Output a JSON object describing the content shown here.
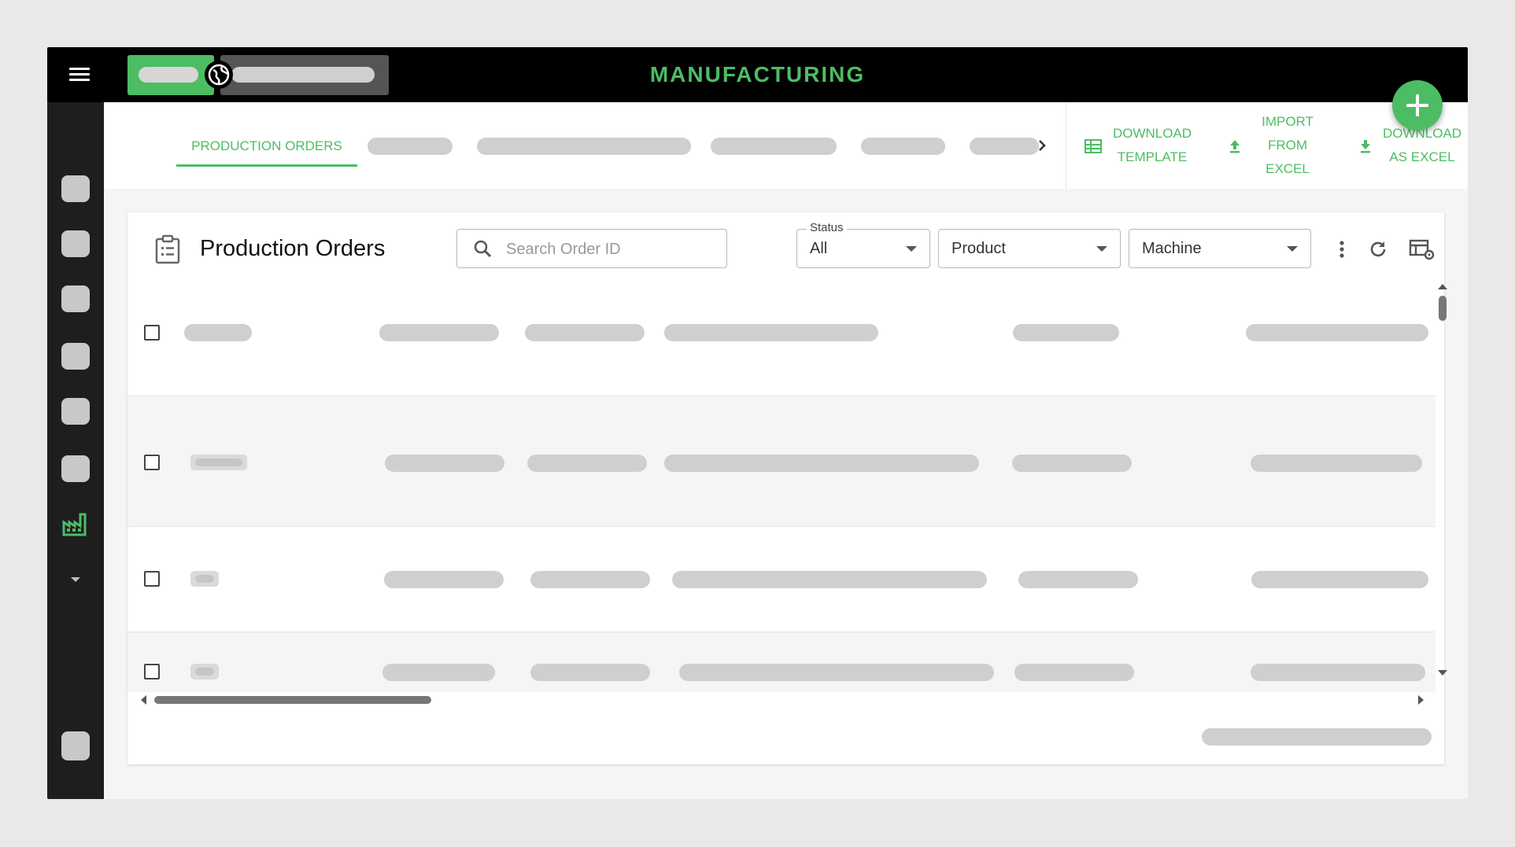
{
  "app": {
    "title": "MANUFACTURING",
    "accent_color": "#4cbd63"
  },
  "topbar": {
    "menu_icon": "hamburger-menu-icon",
    "globe_icon": "globe-icon",
    "add_icon": "plus-icon"
  },
  "tabs": {
    "active_label": "PRODUCTION ORDERS",
    "scroll_icon": "chevron-right-icon"
  },
  "actions": {
    "download_template": "DOWNLOAD TEMPLATE",
    "import_excel": "IMPORT FROM EXCEL",
    "download_excel": "DOWNLOAD AS EXCEL"
  },
  "page": {
    "title": "Production Orders",
    "search_placeholder": "Search Order ID",
    "filters": {
      "status_label": "Status",
      "status_value": "All",
      "product_value": "Product",
      "machine_value": "Machine"
    },
    "tools": [
      "more-vert-icon",
      "refresh-icon",
      "table-settings-icon"
    ]
  }
}
